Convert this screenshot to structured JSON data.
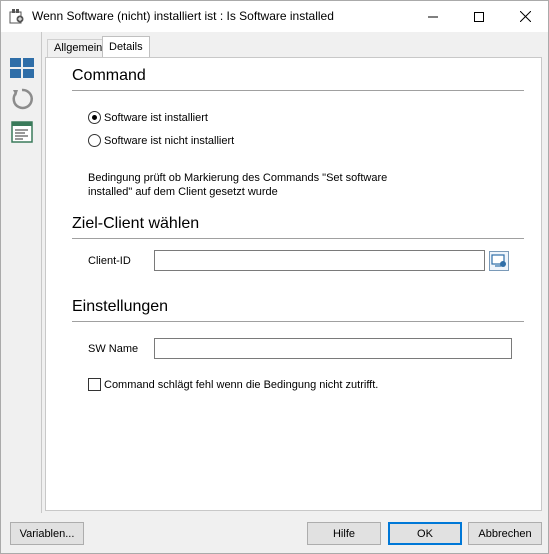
{
  "window": {
    "title": "Wenn Software (nicht) installiert ist : Is Software installed",
    "app_icon": "app-icon",
    "controls": {
      "minimize": "minimize-icon",
      "maximize": "maximize-icon",
      "close": "close-icon"
    }
  },
  "toolbar": {
    "icons": [
      "windows-tiles-icon",
      "refresh-icon",
      "document-list-icon"
    ]
  },
  "tabs": [
    {
      "label": "Allgemein",
      "active": false
    },
    {
      "label": "Details",
      "active": true
    }
  ],
  "command": {
    "title": "Command",
    "options": [
      {
        "label": "Software ist installiert",
        "checked": true
      },
      {
        "label": "Software ist nicht installiert",
        "checked": false
      }
    ],
    "description": "Bedingung prüft ob Markierung des Commands \"Set software installed\" auf dem Client gesetzt wurde"
  },
  "target": {
    "title": "Ziel-Client wählen",
    "client_id_label": "Client-ID",
    "client_id_value": ""
  },
  "settings": {
    "title": "Einstellungen",
    "sw_name_label": "SW Name",
    "sw_name_value": "",
    "fail_checkbox_label": "Command schlägt fehl wenn die Bedingung nicht zutrifft.",
    "fail_checkbox_checked": false
  },
  "buttons": {
    "variables": "Variablen...",
    "help": "Hilfe",
    "ok": "OK",
    "cancel": "Abbrechen"
  },
  "colors": {
    "accent": "#0078d7",
    "icon_blue": "#2f6ea8"
  }
}
